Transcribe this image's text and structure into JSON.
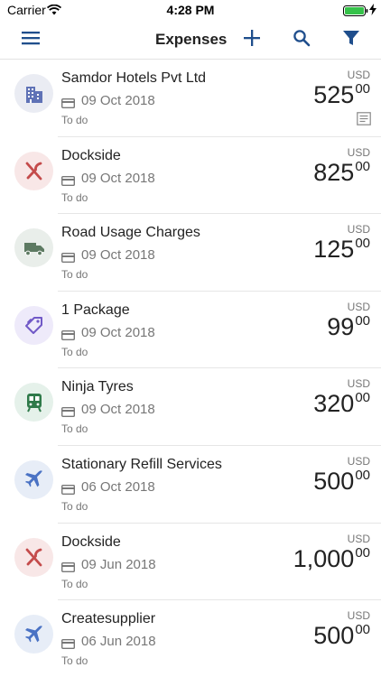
{
  "status_bar": {
    "carrier": "Carrier",
    "time": "4:28 PM"
  },
  "nav": {
    "title": "Expenses",
    "icons": [
      "menu-icon",
      "plus-icon",
      "search-icon",
      "filter-icon"
    ],
    "accent_color": "#1f4e8c"
  },
  "expenses": [
    {
      "merchant": "Samdor Hotels Pvt Ltd",
      "date": "09 Oct 2018",
      "status": "To do",
      "currency": "USD",
      "amount_main": "525",
      "amount_dec": "00",
      "category_icon": "hotel-icon",
      "has_receipt": true,
      "icon_color": "#5f72b6",
      "bg_color": "#eaecf3"
    },
    {
      "merchant": "Dockside",
      "date": "09 Oct 2018",
      "status": "To do",
      "currency": "USD",
      "amount_main": "825",
      "amount_dec": "00",
      "category_icon": "meal-icon",
      "has_receipt": false,
      "icon_color": "#c44b4b",
      "bg_color": "#f8e7e7"
    },
    {
      "merchant": "Road Usage Charges",
      "date": "09 Oct 2018",
      "status": "To do",
      "currency": "USD",
      "amount_main": "125",
      "amount_dec": "00",
      "category_icon": "truck-icon",
      "has_receipt": false,
      "icon_color": "#5d7a62",
      "bg_color": "#e9eeea"
    },
    {
      "merchant": "1 Package",
      "date": "09 Oct 2018",
      "status": "To do",
      "currency": "USD",
      "amount_main": "99",
      "amount_dec": "00",
      "category_icon": "tag-icon",
      "has_receipt": false,
      "icon_color": "#7159c7",
      "bg_color": "#eeeafa"
    },
    {
      "merchant": "Ninja Tyres",
      "date": "09 Oct 2018",
      "status": "To do",
      "currency": "USD",
      "amount_main": "320",
      "amount_dec": "00",
      "category_icon": "train-icon",
      "has_receipt": false,
      "icon_color": "#2f7a4a",
      "bg_color": "#e5f1ea"
    },
    {
      "merchant": "Stationary Refill Services",
      "date": "06 Oct 2018",
      "status": "To do",
      "currency": "USD",
      "amount_main": "500",
      "amount_dec": "00",
      "category_icon": "airplane-icon",
      "has_receipt": false,
      "icon_color": "#4a72c4",
      "bg_color": "#e7edf7"
    },
    {
      "merchant": "Dockside",
      "date": "09 Jun 2018",
      "status": "To do",
      "currency": "USD",
      "amount_main": "1,000",
      "amount_dec": "00",
      "category_icon": "meal-icon",
      "has_receipt": false,
      "icon_color": "#c44b4b",
      "bg_color": "#f8e7e7"
    },
    {
      "merchant": "Createsupplier",
      "date": "06 Jun 2018",
      "status": "To do",
      "currency": "USD",
      "amount_main": "500",
      "amount_dec": "00",
      "category_icon": "airplane-icon",
      "has_receipt": false,
      "icon_color": "#4a72c4",
      "bg_color": "#e7edf7"
    }
  ]
}
